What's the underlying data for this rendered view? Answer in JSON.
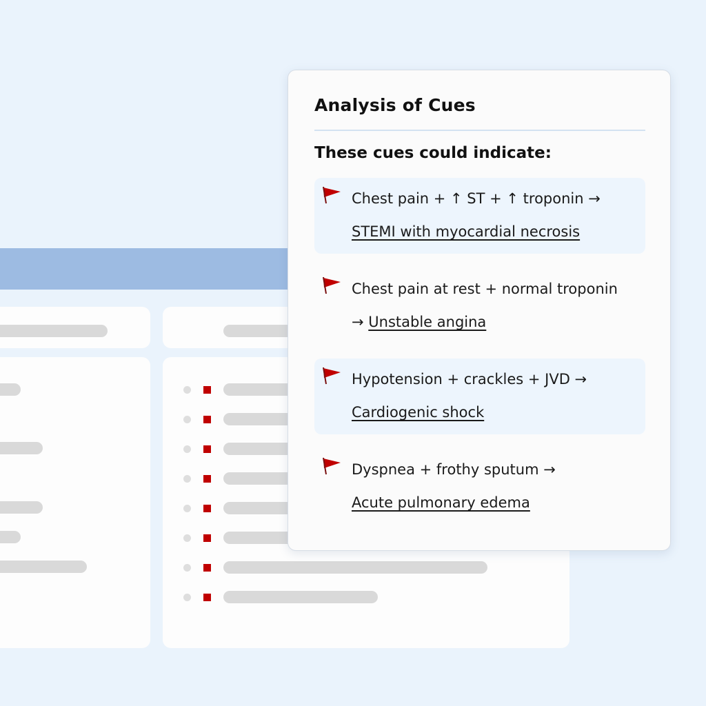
{
  "colors": {
    "background": "#eaf3fc",
    "header_bar": "#9dbbe2",
    "flag": "#c00000",
    "highlight": "#edf5fd"
  },
  "panel": {
    "title": "Analysis of Cues",
    "subtitle": "These cues could indicate:",
    "cues": [
      {
        "cues_text": "Chest pain + ↑ ST + ↑ troponin →",
        "arrow_prefix": "",
        "diagnosis": "STEMI with myocardial necrosis",
        "icon": "red-flag-icon",
        "highlighted": true
      },
      {
        "cues_text": "Chest pain at rest + normal troponin",
        "arrow_prefix": "→ ",
        "diagnosis": "Unstable angina",
        "icon": "red-flag-icon",
        "highlighted": false
      },
      {
        "cues_text": "Hypotension + crackles + JVD →",
        "arrow_prefix": "",
        "diagnosis": "Cardiogenic shock",
        "icon": "red-flag-icon",
        "highlighted": true
      },
      {
        "cues_text": "Dyspnea + frothy sputum →",
        "arrow_prefix": "",
        "diagnosis": "Acute pulmonary edema",
        "icon": "red-flag-icon",
        "highlighted": false
      }
    ]
  }
}
